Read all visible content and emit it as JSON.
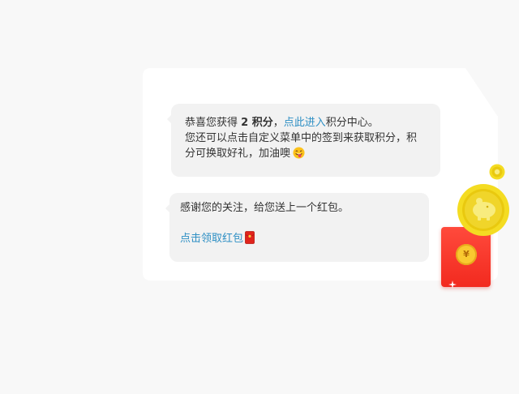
{
  "messages": {
    "first": {
      "congrats_prefix": "恭喜您获得 ",
      "points_text": "2 积分",
      "comma": "，",
      "link_text": "点此进入",
      "link_suffix": "积分中心。",
      "line2": "您还可以点击自定义菜单中的签到来获取积分，积",
      "line3": "分可换取好礼，加油噢",
      "emoji_icon": "grinning-tongue-emoji-icon"
    },
    "second": {
      "thanks_text": "感谢您的关注，给您送上一个红包。",
      "link_text": "点击领取红包",
      "envelope_icon": "red-envelope-icon"
    }
  },
  "illustration": {
    "packet_symbol": "¥",
    "icons": [
      "red-packet-icon",
      "piggy-bank-coin-icon",
      "small-coin-icon"
    ]
  },
  "colors": {
    "link": "#2e8fc4",
    "bubble": "#f2f2f2",
    "panel": "#ffffff",
    "red_packet": "#f22a1f",
    "coin": "#f9c930"
  }
}
